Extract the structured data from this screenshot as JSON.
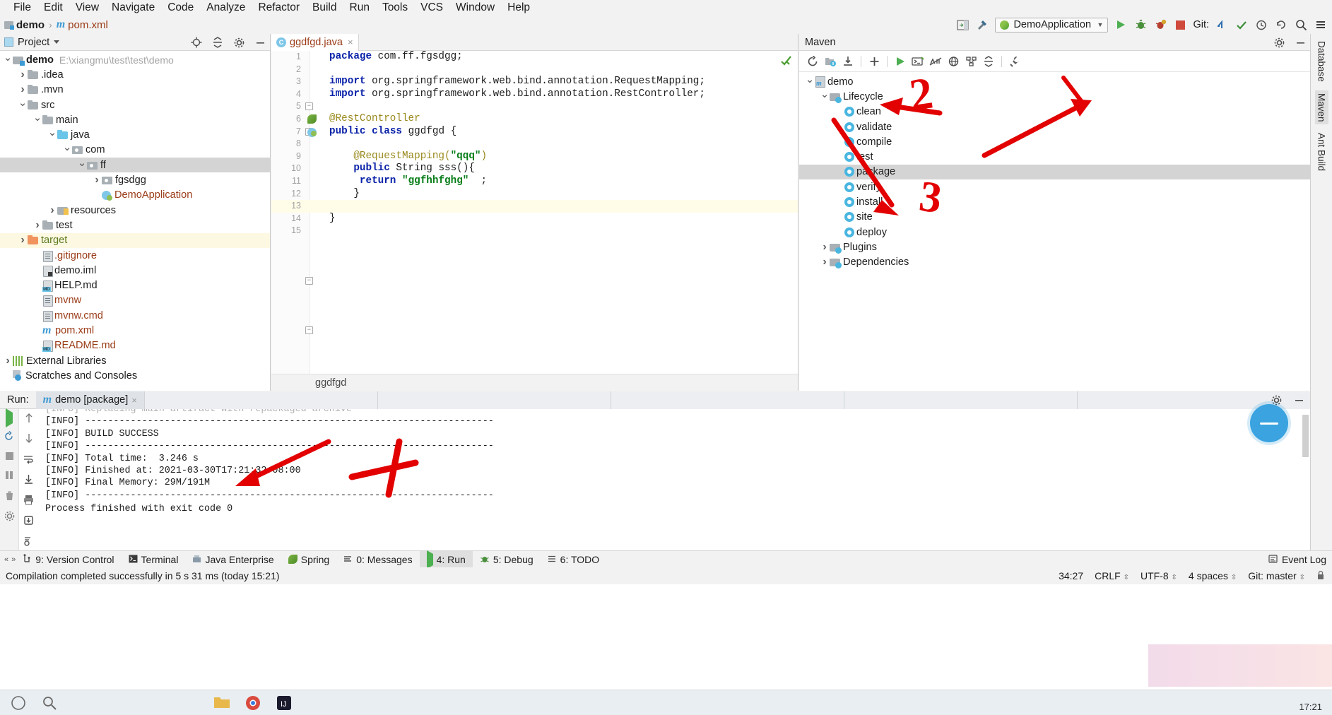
{
  "menu": {
    "items": [
      "File",
      "Edit",
      "View",
      "Navigate",
      "Code",
      "Analyze",
      "Refactor",
      "Build",
      "Run",
      "Tools",
      "VCS",
      "Window",
      "Help"
    ]
  },
  "navbar": {
    "project": "demo",
    "separator": "›",
    "file": "pom.xml",
    "run_config": "DemoApplication",
    "git_label": "Git:",
    "icons": {
      "run": "run-icon",
      "debug": "debug-icon",
      "coverage": "coverage-icon",
      "stop": "stop-icon",
      "search": "search-icon",
      "hammer": "build-icon",
      "preview": "preview-icon"
    }
  },
  "project_panel": {
    "title": "Project",
    "icons": {
      "locate": "locate-icon",
      "collapse": "collapse-all-icon",
      "settings": "gear-icon",
      "hide": "minimize-icon"
    },
    "tree": [
      {
        "label": "demo",
        "path": "E:\\xiangmu\\test\\test\\demo",
        "depth": 0,
        "arrow": "open",
        "icon": "module-folder",
        "bold": true,
        "state": ""
      },
      {
        "label": ".idea",
        "path": "",
        "depth": 1,
        "arrow": "closed",
        "icon": "folder-gray",
        "bold": false,
        "state": ""
      },
      {
        "label": ".mvn",
        "path": "",
        "depth": 1,
        "arrow": "closed",
        "icon": "folder-gray",
        "bold": false,
        "state": ""
      },
      {
        "label": "src",
        "path": "",
        "depth": 1,
        "arrow": "open",
        "icon": "folder-gray",
        "bold": false,
        "state": ""
      },
      {
        "label": "main",
        "path": "",
        "depth": 2,
        "arrow": "open",
        "icon": "folder-gray",
        "bold": false,
        "state": ""
      },
      {
        "label": "java",
        "path": "",
        "depth": 3,
        "arrow": "open",
        "icon": "folder-blue",
        "bold": false,
        "state": ""
      },
      {
        "label": "com",
        "path": "",
        "depth": 4,
        "arrow": "open",
        "icon": "folder-pkg",
        "bold": false,
        "state": ""
      },
      {
        "label": "ff",
        "path": "",
        "depth": 5,
        "arrow": "open",
        "icon": "folder-pkg",
        "bold": false,
        "state": "selected"
      },
      {
        "label": "fgsdgg",
        "path": "",
        "depth": 6,
        "arrow": "closed",
        "icon": "folder-pkg",
        "bold": false,
        "state": ""
      },
      {
        "label": "DemoApplication",
        "path": "",
        "depth": 6,
        "arrow": "none",
        "icon": "spring-class",
        "bold": false,
        "state": "",
        "color": "orange"
      },
      {
        "label": "resources",
        "path": "",
        "depth": 3,
        "arrow": "closed",
        "icon": "folder-resources",
        "bold": false,
        "state": ""
      },
      {
        "label": "test",
        "path": "",
        "depth": 2,
        "arrow": "closed",
        "icon": "folder-gray",
        "bold": false,
        "state": ""
      },
      {
        "label": "target",
        "path": "",
        "depth": 1,
        "arrow": "closed",
        "icon": "folder-orange",
        "bold": false,
        "state": "highlight",
        "color": "green"
      },
      {
        "label": ".gitignore",
        "path": "",
        "depth": 2,
        "arrow": "none",
        "icon": "file-text",
        "bold": false,
        "state": "",
        "color": "orange"
      },
      {
        "label": "demo.iml",
        "path": "",
        "depth": 2,
        "arrow": "none",
        "icon": "file-iml",
        "bold": false,
        "state": ""
      },
      {
        "label": "HELP.md",
        "path": "",
        "depth": 2,
        "arrow": "none",
        "icon": "file-md",
        "bold": false,
        "state": ""
      },
      {
        "label": "mvnw",
        "path": "",
        "depth": 2,
        "arrow": "none",
        "icon": "file-text",
        "bold": false,
        "state": "",
        "color": "orange"
      },
      {
        "label": "mvnw.cmd",
        "path": "",
        "depth": 2,
        "arrow": "none",
        "icon": "file-text",
        "bold": false,
        "state": "",
        "color": "orange"
      },
      {
        "label": "pom.xml",
        "path": "",
        "depth": 2,
        "arrow": "none",
        "icon": "file-maven",
        "bold": false,
        "state": "",
        "color": "orange"
      },
      {
        "label": "README.md",
        "path": "",
        "depth": 2,
        "arrow": "none",
        "icon": "file-md",
        "bold": false,
        "state": "",
        "color": "orange"
      },
      {
        "label": "External Libraries",
        "path": "",
        "depth": 0,
        "arrow": "closed",
        "icon": "libraries",
        "bold": false,
        "state": ""
      },
      {
        "label": "Scratches and Consoles",
        "path": "",
        "depth": 0,
        "arrow": "none",
        "icon": "scratches",
        "bold": false,
        "state": ""
      }
    ]
  },
  "editor": {
    "tab": {
      "label": "ggdfgd.java",
      "icon": "class-icon",
      "close": "×"
    },
    "breadcrumb": "ggdfgd",
    "lines": [
      {
        "n": 1,
        "segments": [
          {
            "t": "package",
            "c": "kw"
          },
          {
            "t": " com.ff.fgsdgg;",
            "c": "pln"
          }
        ]
      },
      {
        "n": 2,
        "segments": []
      },
      {
        "n": 3,
        "fold": "minus",
        "segments": [
          {
            "t": "import",
            "c": "kw"
          },
          {
            "t": " org.springframework.web.bind.annotation.",
            "c": "pln"
          },
          {
            "t": "RequestMapping",
            "c": "id"
          },
          {
            "t": ";",
            "c": "pln"
          }
        ]
      },
      {
        "n": 4,
        "fold": "minus",
        "segments": [
          {
            "t": "import",
            "c": "kw"
          },
          {
            "t": " org.springframework.web.bind.annotation.",
            "c": "pln"
          },
          {
            "t": "RestController",
            "c": "id"
          },
          {
            "t": ";",
            "c": "pln"
          }
        ]
      },
      {
        "n": 5,
        "segments": []
      },
      {
        "n": 6,
        "gicon": "spring-bean-icon",
        "segments": [
          {
            "t": "@RestController",
            "c": "ann"
          }
        ]
      },
      {
        "n": 7,
        "gicon": "class-run-icon",
        "segments": [
          {
            "t": "public",
            "c": "kw"
          },
          {
            "t": " ",
            "c": "pln"
          },
          {
            "t": "class",
            "c": "kw"
          },
          {
            "t": " ggdfgd {",
            "c": "pln"
          }
        ]
      },
      {
        "n": 8,
        "segments": []
      },
      {
        "n": 9,
        "segments": [
          {
            "t": "    @RequestMapping(",
            "c": "ann"
          },
          {
            "t": "\"qqq\"",
            "c": "str"
          },
          {
            "t": ")",
            "c": "ann"
          }
        ]
      },
      {
        "n": 10,
        "fold": "minus",
        "segments": [
          {
            "t": "    ",
            "c": "pln"
          },
          {
            "t": "public",
            "c": "kw"
          },
          {
            "t": " String sss(){",
            "c": "pln"
          }
        ]
      },
      {
        "n": 11,
        "segments": [
          {
            "t": "     ",
            "c": "pln"
          },
          {
            "t": "return",
            "c": "kw"
          },
          {
            "t": " ",
            "c": "pln"
          },
          {
            "t": "\"ggfhhfghg\"",
            "c": "str"
          },
          {
            "t": "  ;",
            "c": "pln"
          }
        ]
      },
      {
        "n": 12,
        "fold": "minus",
        "segments": [
          {
            "t": "    }",
            "c": "pln"
          }
        ]
      },
      {
        "n": 13,
        "current": true,
        "segments": []
      },
      {
        "n": 14,
        "segments": [
          {
            "t": "}",
            "c": "pln"
          }
        ]
      },
      {
        "n": 15,
        "segments": []
      }
    ]
  },
  "maven": {
    "title": "Maven",
    "toolbar_icons": [
      "reload-icon",
      "generate-sources-icon",
      "download-sources-icon",
      "add-icon",
      "run-maven-goal-icon",
      "execute-icon",
      "toggle-skip-tests-icon",
      "offline-mode-icon",
      "show-diagram-icon",
      "expand-collapse-icon",
      "settings-wrench-icon"
    ],
    "header_icons": {
      "settings": "gear-icon",
      "hide": "minimize-icon"
    },
    "tree": [
      {
        "label": "demo",
        "depth": 0,
        "arrow": "open",
        "icon": "maven-module-icon",
        "state": ""
      },
      {
        "label": "Lifecycle",
        "depth": 1,
        "arrow": "open",
        "icon": "lifecycle-folder-icon",
        "state": ""
      },
      {
        "label": "clean",
        "depth": 2,
        "arrow": "none",
        "icon": "maven-goal-icon",
        "state": ""
      },
      {
        "label": "validate",
        "depth": 2,
        "arrow": "none",
        "icon": "maven-goal-icon",
        "state": ""
      },
      {
        "label": "compile",
        "depth": 2,
        "arrow": "none",
        "icon": "maven-goal-icon",
        "state": ""
      },
      {
        "label": "test",
        "depth": 2,
        "arrow": "none",
        "icon": "maven-goal-icon",
        "state": ""
      },
      {
        "label": "package",
        "depth": 2,
        "arrow": "none",
        "icon": "maven-goal-icon",
        "state": "selected"
      },
      {
        "label": "verify",
        "depth": 2,
        "arrow": "none",
        "icon": "maven-goal-icon",
        "state": ""
      },
      {
        "label": "install",
        "depth": 2,
        "arrow": "none",
        "icon": "maven-goal-icon",
        "state": ""
      },
      {
        "label": "site",
        "depth": 2,
        "arrow": "none",
        "icon": "maven-goal-icon",
        "state": ""
      },
      {
        "label": "deploy",
        "depth": 2,
        "arrow": "none",
        "icon": "maven-goal-icon",
        "state": ""
      },
      {
        "label": "Plugins",
        "depth": 1,
        "arrow": "closed",
        "icon": "plugins-folder-icon",
        "state": ""
      },
      {
        "label": "Dependencies",
        "depth": 1,
        "arrow": "closed",
        "icon": "dependencies-folder-icon",
        "state": ""
      }
    ]
  },
  "right_strip": {
    "tabs": [
      "Database",
      "Maven",
      "Ant Build"
    ],
    "active": "Maven"
  },
  "run_panel": {
    "label": "Run:",
    "tab": {
      "label": "demo [package]",
      "icon": "maven-icon",
      "close": "×"
    },
    "header_icons": {
      "settings": "gear-icon",
      "hide": "minimize-icon"
    },
    "sidebar_icons": [
      "rerun-icon",
      "rerun-failed-icon",
      "stop-icon",
      "up-icon",
      "down-icon",
      "soft-wrap-icon",
      "scroll-to-end-icon",
      "print-icon",
      "export-icon",
      "clear-all-icon",
      "settings-icon"
    ],
    "console": [
      "[INFO] Replacing main artifact with repackaged archive",
      "[INFO] ------------------------------------------------------------------------",
      "[INFO] BUILD SUCCESS",
      "[INFO] ------------------------------------------------------------------------",
      "[INFO] Total time:  3.246 s",
      "[INFO] Finished at: 2021-03-30T17:21:32+08:00",
      "[INFO] Final Memory: 29M/191M",
      "[INFO] ------------------------------------------------------------------------",
      "",
      "Process finished with exit code 0"
    ]
  },
  "bottom_bar": {
    "items": [
      {
        "label": "9: Version Control",
        "icon": "version-control-icon",
        "active": false
      },
      {
        "label": "Terminal",
        "icon": "terminal-icon",
        "active": false
      },
      {
        "label": "Java Enterprise",
        "icon": "java-enterprise-icon",
        "active": false
      },
      {
        "label": "Spring",
        "icon": "spring-icon",
        "active": false
      },
      {
        "label": "0: Messages",
        "icon": "messages-icon",
        "active": false
      },
      {
        "label": "4: Run",
        "icon": "run-icon",
        "active": true
      },
      {
        "label": "5: Debug",
        "icon": "debug-icon",
        "active": false
      },
      {
        "label": "6: TODO",
        "icon": "todo-icon",
        "active": false
      }
    ],
    "right": {
      "label": "Event Log",
      "icon": "event-log-icon"
    }
  },
  "status_bar": {
    "message": "Compilation completed successfully in 5 s 31 ms (today 15:21)",
    "caret": "34:27",
    "line_separator": "CRLF",
    "encoding": "UTF-8",
    "indent": "4 spaces",
    "branch": "Git: master",
    "chevron": "↕"
  },
  "annotations": [
    {
      "id": "arrow-lifecycle",
      "type": "arrow",
      "note": "red arrow pointing at Lifecycle node"
    },
    {
      "id": "numeral-2",
      "type": "text",
      "text": "2"
    },
    {
      "id": "arrow-maven-tab",
      "type": "arrow",
      "note": "red arrow pointing at right Maven tool tab"
    },
    {
      "id": "arrow-package",
      "type": "arrow",
      "note": "red arrow pointing at package goal"
    },
    {
      "id": "numeral-3",
      "type": "text",
      "text": "3"
    },
    {
      "id": "arrow-total-time",
      "type": "arrow",
      "note": "red arrow pointing at Total time line"
    },
    {
      "id": "numeral-4",
      "type": "text",
      "text": "4"
    }
  ],
  "taskbar": {
    "time": "17:21"
  }
}
